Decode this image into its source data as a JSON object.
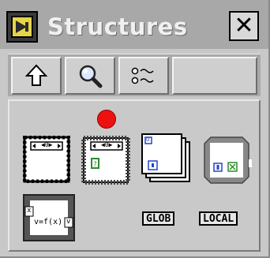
{
  "window": {
    "title": "Structures",
    "close_label": "✕",
    "app_icon": "labview-structures-icon"
  },
  "toolbar": {
    "buttons": [
      {
        "icon": "up-arrow-icon"
      },
      {
        "icon": "magnifier-search-icon"
      },
      {
        "icon": "list-options-icon"
      }
    ]
  },
  "palette": {
    "items": [
      {
        "icon": "for-loop-icon",
        "label": "◀0▶"
      },
      {
        "icon": "while-loop-icon",
        "label": "◀0▶"
      },
      {
        "icon": "sequence-structure-icon",
        "label": "0"
      },
      {
        "icon": "case-structure-icon",
        "label": ""
      },
      {
        "icon": "formula-node-icon",
        "label": "v=f(x)"
      },
      {
        "icon": "global-variable-icon",
        "label": "GLOB"
      },
      {
        "icon": "local-variable-icon",
        "label": "LOCAL"
      }
    ],
    "marker": {
      "icon": "red-dot-icon",
      "color": "#ee1111"
    }
  },
  "colors": {
    "titlebar": "#a8a8a8",
    "window_bg": "#c8c8c8",
    "app_icon_yellow": "#e7d44a"
  }
}
